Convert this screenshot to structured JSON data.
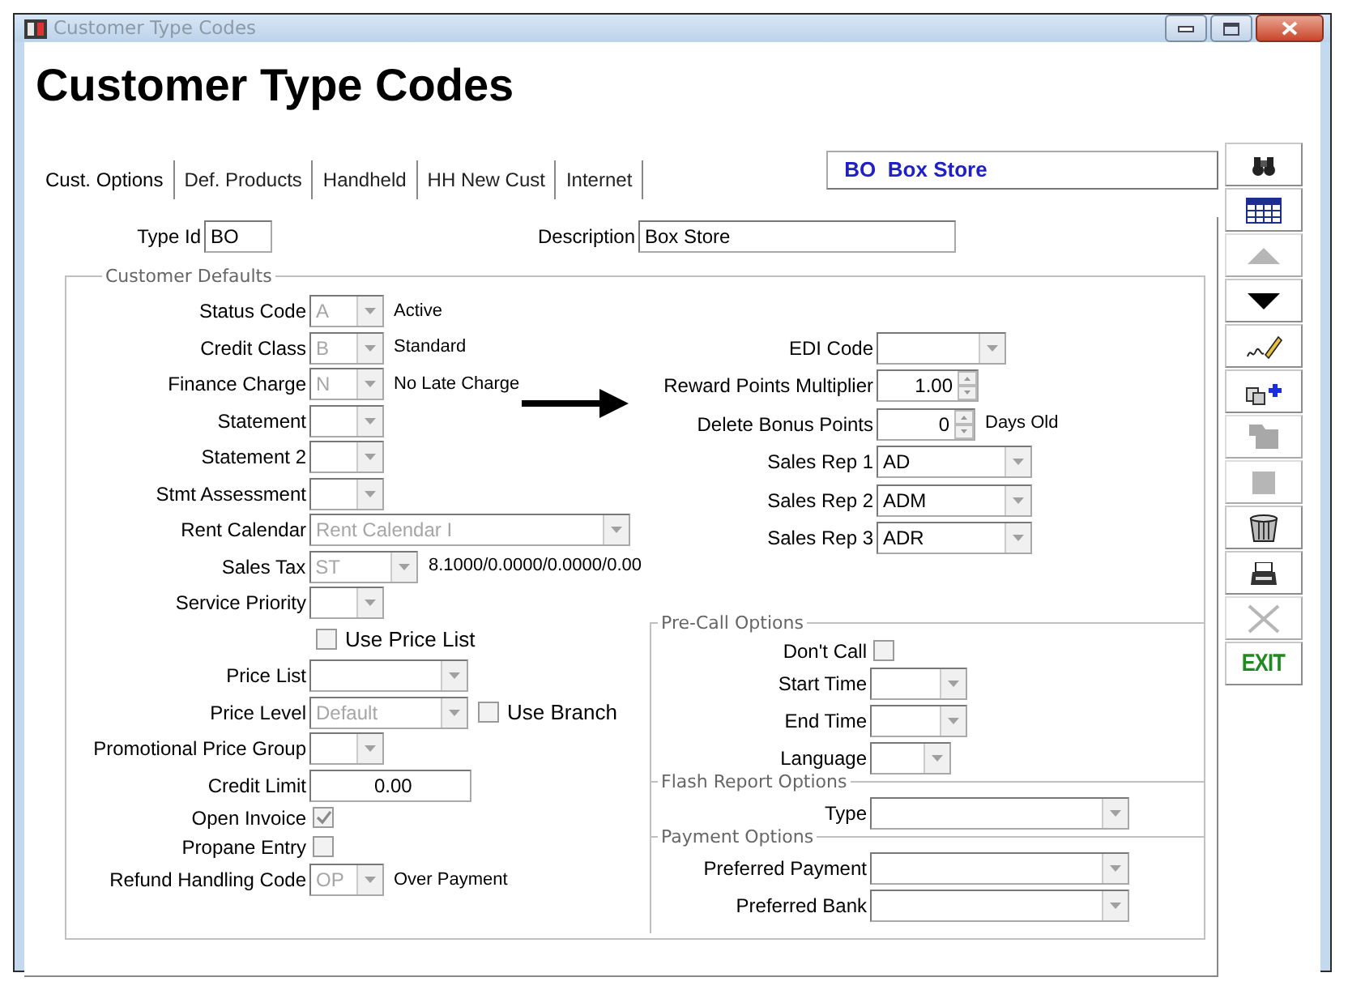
{
  "window": {
    "title": "Customer Type Codes"
  },
  "heading": "Customer Type Codes",
  "tabs": [
    {
      "label": "Cust. Options",
      "selected": true
    },
    {
      "label": "Def. Products",
      "selected": false
    },
    {
      "label": "Handheld",
      "selected": false
    },
    {
      "label": "HH New Cust",
      "selected": false
    },
    {
      "label": "Internet",
      "selected": false
    }
  ],
  "record_banner": "BO  Box Store",
  "type_id": {
    "label": "Type Id",
    "value": "BO"
  },
  "description": {
    "label": "Description",
    "value": "Box Store"
  },
  "customer_defaults": {
    "title": "Customer Defaults",
    "fields": [
      {
        "kind": "combo",
        "label": "Status Code",
        "value": "A",
        "disabled": true,
        "note": "Active"
      },
      {
        "kind": "combo",
        "label": "Credit Class",
        "value": "B",
        "disabled": true,
        "note": "Standard"
      },
      {
        "kind": "combo",
        "label": "Finance Charge",
        "value": "N",
        "disabled": true,
        "note": "No Late Charge"
      },
      {
        "kind": "combo",
        "label": "Statement"
      },
      {
        "kind": "combo",
        "label": "Statement 2"
      },
      {
        "kind": "combo",
        "label": "Stmt Assessment"
      },
      {
        "kind": "combo",
        "label": "Rent Calendar",
        "value": "Rent Calendar I",
        "disabled": true
      },
      {
        "kind": "combo",
        "label": "Sales Tax",
        "value": "ST",
        "disabled": true,
        "note": "8.1000/0.0000/0.0000/0.00"
      },
      {
        "kind": "combo",
        "label": "Service Priority"
      },
      {
        "kind": "check_only",
        "label": "Use Price List",
        "checked": false
      },
      {
        "kind": "combo",
        "label": "Price List"
      },
      {
        "kind": "combo",
        "label": "Price Level",
        "value": "Default",
        "disabled": true,
        "extra_check": {
          "label": "Use Branch",
          "checked": false
        }
      },
      {
        "kind": "combo",
        "label": "Promotional Price Group"
      },
      {
        "kind": "input",
        "label": "Credit Limit",
        "value": "0.00"
      },
      {
        "kind": "checkbox",
        "label": "Open Invoice",
        "checked": true
      },
      {
        "kind": "checkbox",
        "label": "Propane Entry",
        "checked": false
      },
      {
        "kind": "combo",
        "label": "Refund Handling Code",
        "value": "OP",
        "disabled": true,
        "note": "Over Payment"
      }
    ]
  },
  "right_fields": [
    {
      "kind": "combo",
      "label": "EDI Code"
    },
    {
      "kind": "spinner",
      "label": "Reward Points Multiplier",
      "value": "1.00"
    },
    {
      "kind": "spinner",
      "label": "Delete Bonus Points",
      "value": "0",
      "note": "Days Old"
    },
    {
      "kind": "combo",
      "label": "Sales Rep 1",
      "value": "AD",
      "disabled": false
    },
    {
      "kind": "combo",
      "label": "Sales Rep 2",
      "value": "ADM",
      "disabled": false
    },
    {
      "kind": "combo",
      "label": "Sales Rep 3",
      "value": "ADR",
      "disabled": false
    }
  ],
  "option_sections": [
    {
      "title": "Pre-Call Options",
      "fields": [
        {
          "kind": "checkbox",
          "label": "Don't Call",
          "checked": false
        },
        {
          "kind": "combo",
          "label": "Start Time"
        },
        {
          "kind": "combo",
          "label": "End Time"
        },
        {
          "kind": "combo",
          "label": "Language"
        }
      ]
    },
    {
      "title": "Flash Report Options",
      "fields": [
        {
          "kind": "combo",
          "label": "Type"
        }
      ]
    },
    {
      "title": "Payment Options",
      "fields": [
        {
          "kind": "combo",
          "label": "Preferred Payment"
        },
        {
          "kind": "combo",
          "label": "Preferred Bank"
        }
      ]
    }
  ],
  "toolbar": [
    {
      "kind": "binoculars",
      "disabled": false
    },
    {
      "kind": "grid",
      "disabled": false
    },
    {
      "kind": "up",
      "disabled": true
    },
    {
      "kind": "down",
      "disabled": false
    },
    {
      "kind": "signature",
      "disabled": false
    },
    {
      "kind": "copy_add",
      "disabled": false
    },
    {
      "kind": "folder",
      "disabled": true
    },
    {
      "kind": "square",
      "disabled": true
    },
    {
      "kind": "trash",
      "disabled": false
    },
    {
      "kind": "printer",
      "disabled": false
    },
    {
      "kind": "cancel",
      "disabled": true
    },
    {
      "kind": "exit",
      "label": "EXIT",
      "disabled": false
    }
  ]
}
